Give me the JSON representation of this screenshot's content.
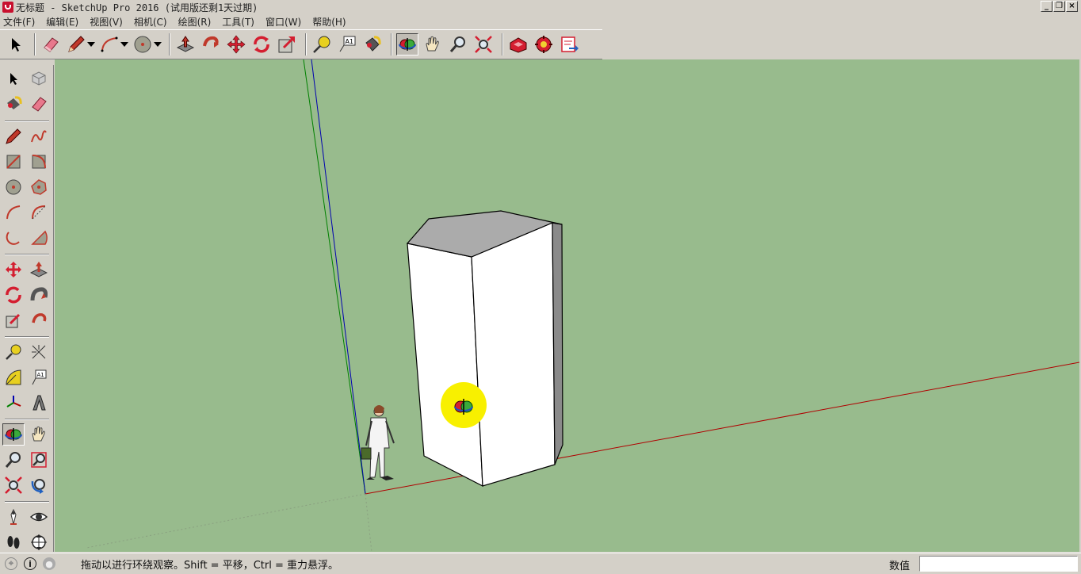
{
  "window": {
    "title": "无标题 - SketchUp Pro 2016 (试用版还剩1天过期)",
    "buttons": {
      "minimize": "_",
      "restore": "❐",
      "close": "×"
    }
  },
  "menu": [
    {
      "label": "文件(F)"
    },
    {
      "label": "编辑(E)"
    },
    {
      "label": "视图(V)"
    },
    {
      "label": "相机(C)"
    },
    {
      "label": "绘图(R)"
    },
    {
      "label": "工具(T)"
    },
    {
      "label": "窗口(W)"
    },
    {
      "label": "帮助(H)"
    }
  ],
  "toolbar": {
    "icons": [
      "select-icon",
      "eraser-icon",
      "pencil-icon",
      "arc-icon",
      "circle-icon",
      "push-pull-icon",
      "follow-me-icon",
      "move-icon",
      "rotate-icon",
      "scale-icon",
      "tape-measure-icon",
      "text-icon",
      "paint-bucket-icon",
      "orbit-icon",
      "pan-icon",
      "zoom-icon",
      "zoom-extents-icon",
      "warehouse-icon",
      "extension-warehouse-icon",
      "share-model-icon"
    ],
    "active": "orbit-icon"
  },
  "left_toolbar": {
    "active": "orbit-icon"
  },
  "viewport": {
    "background": "#98bb8d",
    "axis_colors": {
      "red": "#b00000",
      "green": "#008000",
      "blue": "#0000b0"
    }
  },
  "status": {
    "message": "拖动以进行环绕观察。Shift = 平移，Ctrl = 重力悬浮。",
    "value_label": "数值",
    "value": ""
  }
}
